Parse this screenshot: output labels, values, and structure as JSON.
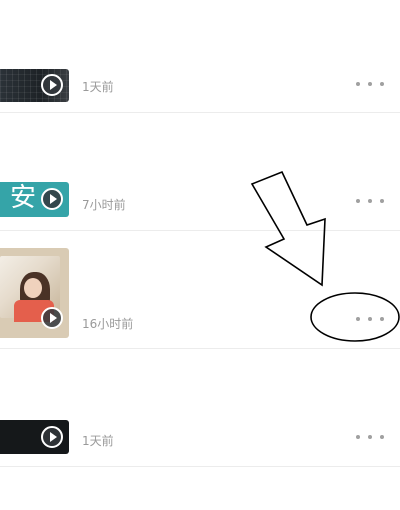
{
  "feed": {
    "items": [
      {
        "time": "1天前",
        "more_icon": "more-horizontal-icon",
        "play_icon": "play-icon"
      },
      {
        "time": "7小时前",
        "thumb_text": "安",
        "more_icon": "more-horizontal-icon",
        "play_icon": "play-icon"
      },
      {
        "time": "16小时前",
        "more_icon": "more-horizontal-icon",
        "play_icon": "play-icon"
      },
      {
        "time": "1天前",
        "more_icon": "more-horizontal-icon",
        "play_icon": "play-icon"
      }
    ]
  },
  "colors": {
    "background": "#ffffff",
    "timestamp": "#9a9a9a",
    "more_dots": "#a0a0a0",
    "divider": "#ececec",
    "teal_thumb": "#35a4a8"
  }
}
